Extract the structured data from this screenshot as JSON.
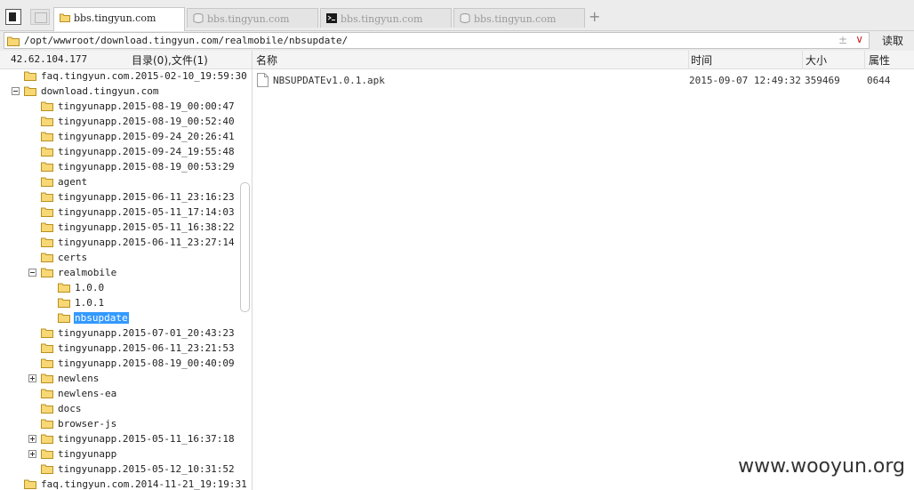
{
  "tabs": [
    {
      "label": "bbs.tingyun.com",
      "icon": "folder-icon",
      "active": true
    },
    {
      "label": "bbs.tingyun.com",
      "icon": "database-icon",
      "active": false
    },
    {
      "label": "bbs.tingyun.com",
      "icon": "terminal-icon",
      "active": false
    },
    {
      "label": "bbs.tingyun.com",
      "icon": "database-icon",
      "active": false
    }
  ],
  "new_tab_label": "+",
  "address": {
    "path": "/opt/wwwroot/download.tingyun.com/realmobile/nbsupdate/",
    "pm": "±",
    "dropdown": "∨",
    "read_label": "读取"
  },
  "left": {
    "ip": "42.62.104.177",
    "counts": "目录(0),文件(1)",
    "tree": [
      {
        "label": "faq.tingyun.com.2015-02-10_19:59:30",
        "depth": 1,
        "expander": ""
      },
      {
        "label": "download.tingyun.com",
        "depth": 1,
        "expander": "minus"
      },
      {
        "label": "tingyunapp.2015-08-19_00:00:47",
        "depth": 2,
        "expander": ""
      },
      {
        "label": "tingyunapp.2015-08-19_00:52:40",
        "depth": 2,
        "expander": ""
      },
      {
        "label": "tingyunapp.2015-09-24_20:26:41",
        "depth": 2,
        "expander": ""
      },
      {
        "label": "tingyunapp.2015-09-24_19:55:48",
        "depth": 2,
        "expander": ""
      },
      {
        "label": "tingyunapp.2015-08-19_00:53:29",
        "depth": 2,
        "expander": ""
      },
      {
        "label": "agent",
        "depth": 2,
        "expander": ""
      },
      {
        "label": "tingyunapp.2015-06-11_23:16:23",
        "depth": 2,
        "expander": ""
      },
      {
        "label": "tingyunapp.2015-05-11_17:14:03",
        "depth": 2,
        "expander": ""
      },
      {
        "label": "tingyunapp.2015-05-11_16:38:22",
        "depth": 2,
        "expander": ""
      },
      {
        "label": "tingyunapp.2015-06-11_23:27:14",
        "depth": 2,
        "expander": ""
      },
      {
        "label": "certs",
        "depth": 2,
        "expander": ""
      },
      {
        "label": "realmobile",
        "depth": 2,
        "expander": "minus"
      },
      {
        "label": "1.0.0",
        "depth": 3,
        "expander": ""
      },
      {
        "label": "1.0.1",
        "depth": 3,
        "expander": ""
      },
      {
        "label": "nbsupdate",
        "depth": 3,
        "expander": "",
        "selected": true
      },
      {
        "label": "tingyunapp.2015-07-01_20:43:23",
        "depth": 2,
        "expander": ""
      },
      {
        "label": "tingyunapp.2015-06-11_23:21:53",
        "depth": 2,
        "expander": ""
      },
      {
        "label": "tingyunapp.2015-08-19_00:40:09",
        "depth": 2,
        "expander": ""
      },
      {
        "label": "newlens",
        "depth": 2,
        "expander": "plus"
      },
      {
        "label": "newlens-ea",
        "depth": 2,
        "expander": ""
      },
      {
        "label": "docs",
        "depth": 2,
        "expander": ""
      },
      {
        "label": "browser-js",
        "depth": 2,
        "expander": ""
      },
      {
        "label": "tingyunapp.2015-05-11_16:37:18",
        "depth": 2,
        "expander": "plus"
      },
      {
        "label": "tingyunapp",
        "depth": 2,
        "expander": "plus"
      },
      {
        "label": "tingyunapp.2015-05-12_10:31:52",
        "depth": 2,
        "expander": ""
      },
      {
        "label": "faq.tingyun.com.2014-11-21_19:19:31",
        "depth": 1,
        "expander": ""
      }
    ]
  },
  "columns": {
    "name": "名称",
    "time": "时间",
    "size": "大小",
    "attr": "属性"
  },
  "files": [
    {
      "name": "NBSUPDATEv1.0.1.apk",
      "time": "2015-09-07 12:49:32",
      "size": "359469",
      "attr": "0644",
      "icon": "file-icon"
    }
  ],
  "watermark": "www.wooyun.org",
  "colors": {
    "folder_fill": "#f8d775",
    "folder_stroke": "#b8901e",
    "selection": "#3399ff",
    "dropdown_accent": "#c8262a"
  }
}
